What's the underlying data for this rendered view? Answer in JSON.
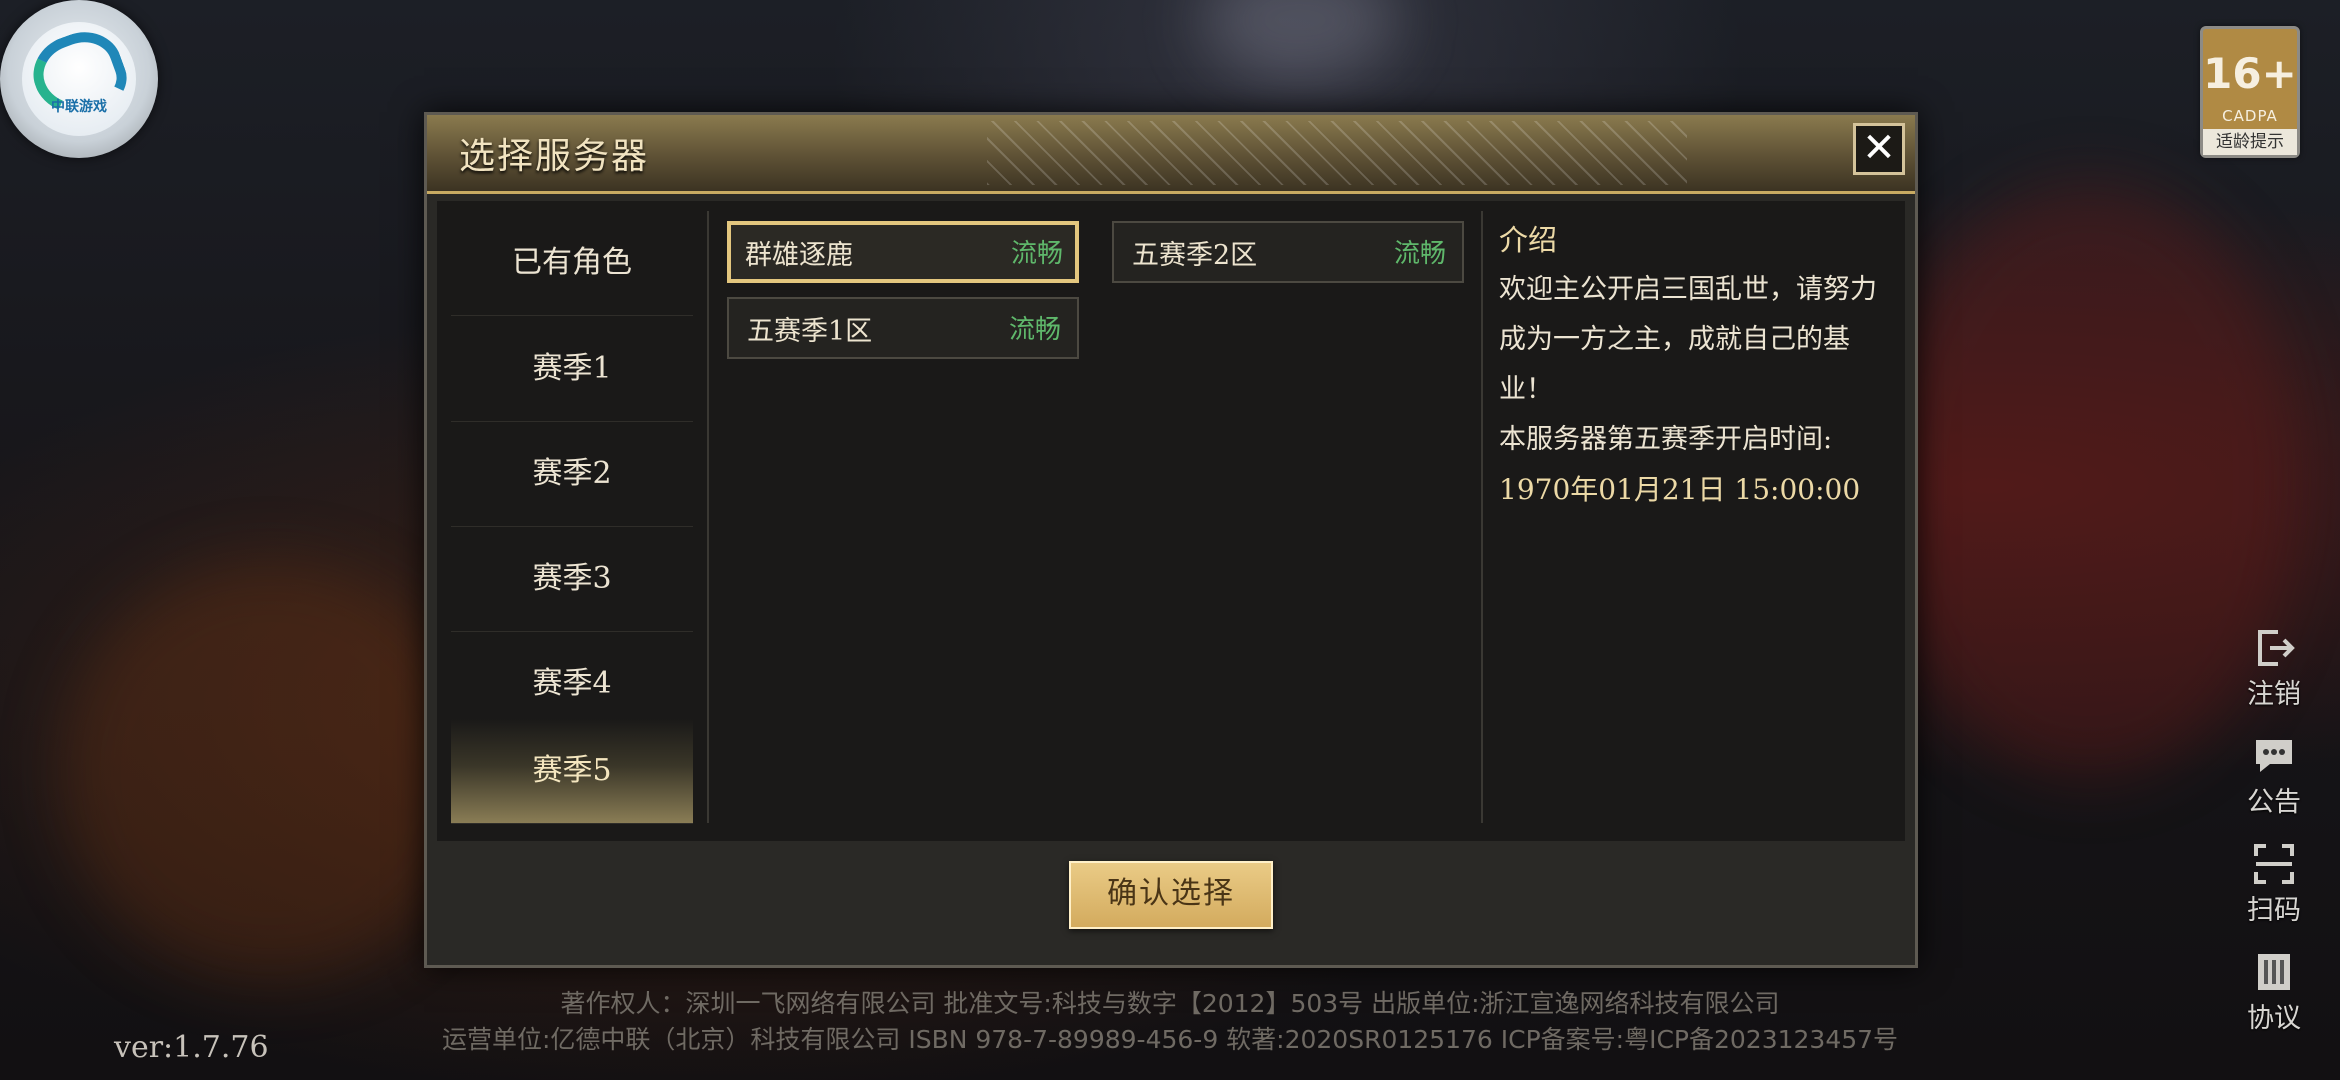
{
  "logo": {
    "text": "中联游戏"
  },
  "age_badge": {
    "rating": "16+",
    "org": "CADPA",
    "tip": "适龄提示"
  },
  "side_actions": [
    {
      "label": "注销",
      "icon": "logout-icon"
    },
    {
      "label": "公告",
      "icon": "announcement-icon"
    },
    {
      "label": "扫码",
      "icon": "scan-icon"
    },
    {
      "label": "协议",
      "icon": "agreement-icon"
    }
  ],
  "dialog": {
    "title": "选择服务器",
    "close_label": "✕",
    "sidebar": [
      {
        "label": "已有角色",
        "active": false
      },
      {
        "label": "赛季1",
        "active": false
      },
      {
        "label": "赛季2",
        "active": false
      },
      {
        "label": "赛季3",
        "active": false
      },
      {
        "label": "赛季4",
        "active": false
      },
      {
        "label": "赛季5",
        "active": true
      }
    ],
    "servers": [
      {
        "name": "群雄逐鹿",
        "status": "流畅",
        "selected": true
      },
      {
        "name": "五赛季2区",
        "status": "流畅",
        "selected": false
      },
      {
        "name": "五赛季1区",
        "status": "流畅",
        "selected": false
      }
    ],
    "intro": {
      "heading": "介绍",
      "body": "欢迎主公开启三国乱世，请努力成为一方之主，成就自己的基业！",
      "open_label": "本服务器第五赛季开启时间:",
      "open_time": "1970年01月21日 15:00:00"
    },
    "confirm_label": "确认选择"
  },
  "footer": {
    "line1": "著作权人：深圳一飞网络有限公司 批准文号:科技与数字【2012】503号 出版单位:浙江宣逸网络科技有限公司",
    "line2": "运营单位:亿德中联（北京）科技有限公司 ISBN 978-7-89989-456-9 软著:2020SR0125176 ICP备案号:粤ICP备2023123457号"
  },
  "version": "ver:1.7.76",
  "colors": {
    "accent_gold": "#e3c67e",
    "status_green": "#5fb86b",
    "confirm_bg": "#d3ab5e"
  }
}
